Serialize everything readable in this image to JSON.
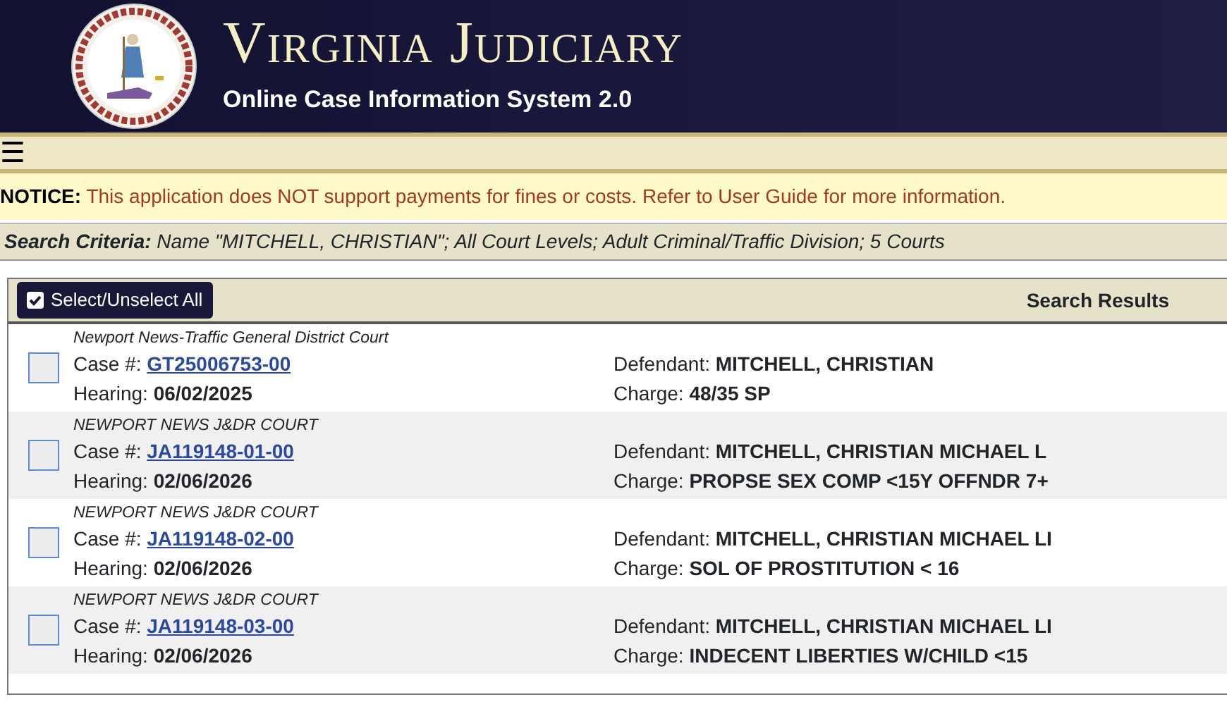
{
  "header": {
    "title": "Virginia Judiciary",
    "subtitle": "Online Case Information System 2.0"
  },
  "menu": {
    "icon": "☰"
  },
  "notice": {
    "label": "NOTICE:",
    "text": "This application does NOT support payments for fines or costs. Refer to User Guide for more information."
  },
  "search_criteria": {
    "label": "Search Criteria:",
    "text": "Name \"MITCHELL, CHRISTIAN\"; All Court Levels; Adult Criminal/Traffic Division; 5 Courts"
  },
  "results": {
    "select_all_button": "Select/Unselect All",
    "title": "Search Results",
    "rows": [
      {
        "court": "Newport News-Traffic General District Court",
        "case_label": "Case #:",
        "case_number": "GT25006753-00",
        "hearing_label": "Hearing:",
        "hearing": "06/02/2025",
        "defendant_label": "Defendant:",
        "defendant": "MITCHELL, CHRISTIAN",
        "charge_label": "Charge:",
        "charge": "48/35 SP",
        "selected": false
      },
      {
        "court": "NEWPORT NEWS J&DR COURT",
        "case_label": "Case #:",
        "case_number": "JA119148-01-00",
        "hearing_label": "Hearing:",
        "hearing": "02/06/2026",
        "defendant_label": "Defendant:",
        "defendant": "MITCHELL, CHRISTIAN MICHAEL L",
        "charge_label": "Charge:",
        "charge": "PROPSE SEX COMP <15Y OFFNDR 7+",
        "selected": false
      },
      {
        "court": "NEWPORT NEWS J&DR COURT",
        "case_label": "Case #:",
        "case_number": "JA119148-02-00",
        "hearing_label": "Hearing:",
        "hearing": "02/06/2026",
        "defendant_label": "Defendant:",
        "defendant": "MITCHELL, CHRISTIAN MICHAEL LI",
        "charge_label": "Charge:",
        "charge": "SOL OF PROSTITUTION < 16",
        "selected": false
      },
      {
        "court": "NEWPORT NEWS J&DR COURT",
        "case_label": "Case #:",
        "case_number": "JA119148-03-00",
        "hearing_label": "Hearing:",
        "hearing": "02/06/2026",
        "defendant_label": "Defendant:",
        "defendant": "MITCHELL, CHRISTIAN MICHAEL LI",
        "charge_label": "Charge:",
        "charge": "INDECENT LIBERTIES W/CHILD <15",
        "selected": false
      }
    ]
  }
}
